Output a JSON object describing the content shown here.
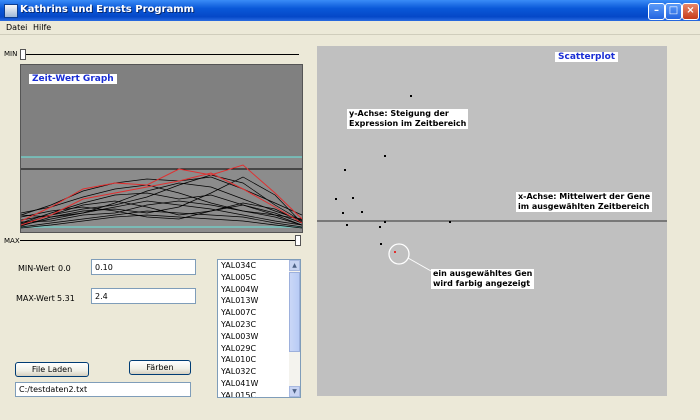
{
  "window": {
    "title": "Kathrins und Ernsts Programm"
  },
  "menu": {
    "file": "Datei",
    "help": "Hilfe"
  },
  "sliders": {
    "min_label": "MIN",
    "max_label": "MAX"
  },
  "graph": {
    "title": "Zeit-Wert Graph"
  },
  "scatter": {
    "title": "Scatterplot",
    "y_axis_note_line1": "y-Achse: Steigung der",
    "y_axis_note_line2": "Expression im Zeitbereich",
    "x_axis_note_line1": "x-Achse: Mittelwert der Gene",
    "x_axis_note_line2": "im ausgewählten Zeitbereich",
    "selected_note_line1": "ein ausgewähltes Gen",
    "selected_note_line2": "wird farbig angezeigt"
  },
  "controls": {
    "min_label": "MIN-Wert",
    "min_value": "0.0",
    "min_input": "0.10",
    "max_label": "MAX-Wert",
    "max_value": "5.31",
    "max_input": "2.4",
    "load_button": "File Laden",
    "color_button": "Färben",
    "file_path": "C:/testdaten2.txt"
  },
  "gene_list": [
    "YAL034C",
    "YAL005C",
    "YAL004W",
    "YAL013W",
    "YAL007C",
    "YAL023C",
    "YAL003W",
    "YAL029C",
    "YAL010C",
    "YAL032C",
    "YAL041W",
    "YAL015C"
  ],
  "colors": {
    "accent": "#1a2ed4",
    "panel": "#c0c0c0",
    "graph_bg": "#808080",
    "highlight": "#e03030"
  }
}
